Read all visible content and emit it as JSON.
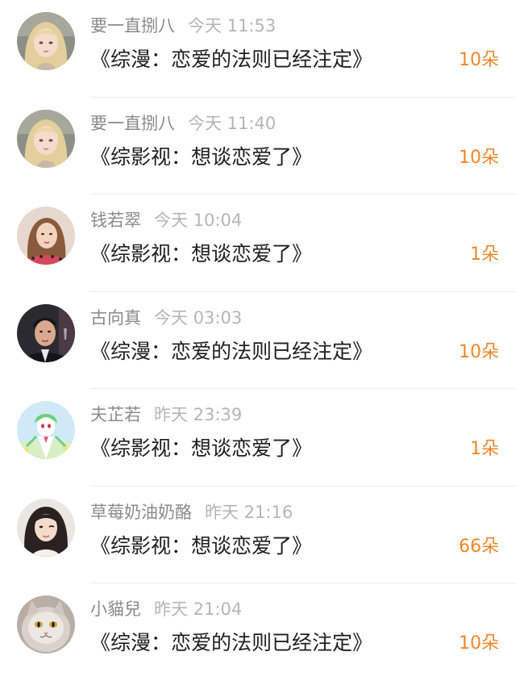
{
  "rows": [
    {
      "name": "要一直捌八",
      "time": "今天 11:53",
      "title": "《综漫：恋爱的法则已经注定》",
      "amount": "10朵",
      "avatar": "anime-girl-avatar"
    },
    {
      "name": "要一直捌八",
      "time": "今天 11:40",
      "title": "《综影视：想谈恋爱了》",
      "amount": "10朵",
      "avatar": "anime-girl-avatar"
    },
    {
      "name": "钱若翠",
      "time": "今天 10:04",
      "title": "《综影视：想谈恋爱了》",
      "amount": "1朵",
      "avatar": "woman-photo-avatar"
    },
    {
      "name": "古向真",
      "time": "今天 03:03",
      "title": "《综漫：恋爱的法则已经注定》",
      "amount": "10朵",
      "avatar": "man-photo-avatar"
    },
    {
      "name": "夫芷若",
      "time": "昨天 23:39",
      "title": "《综影视：想谈恋爱了》",
      "amount": "1朵",
      "avatar": "cartoon-character-avatar"
    },
    {
      "name": "草莓奶油奶酪",
      "time": "昨天 21:16",
      "title": "《综影视：想谈恋爱了》",
      "amount": "66朵",
      "avatar": "girl-photo-avatar"
    },
    {
      "name": "小貓兒",
      "time": "昨天 21:04",
      "title": "《综漫：恋爱的法则已经注定》",
      "amount": "10朵",
      "avatar": "cat-photo-avatar"
    }
  ],
  "colors": {
    "name": "#8a8a8a",
    "time": "#b5b5b5",
    "title": "#1e1e1e",
    "amount": "#f0862a",
    "divider": "#ececec"
  }
}
